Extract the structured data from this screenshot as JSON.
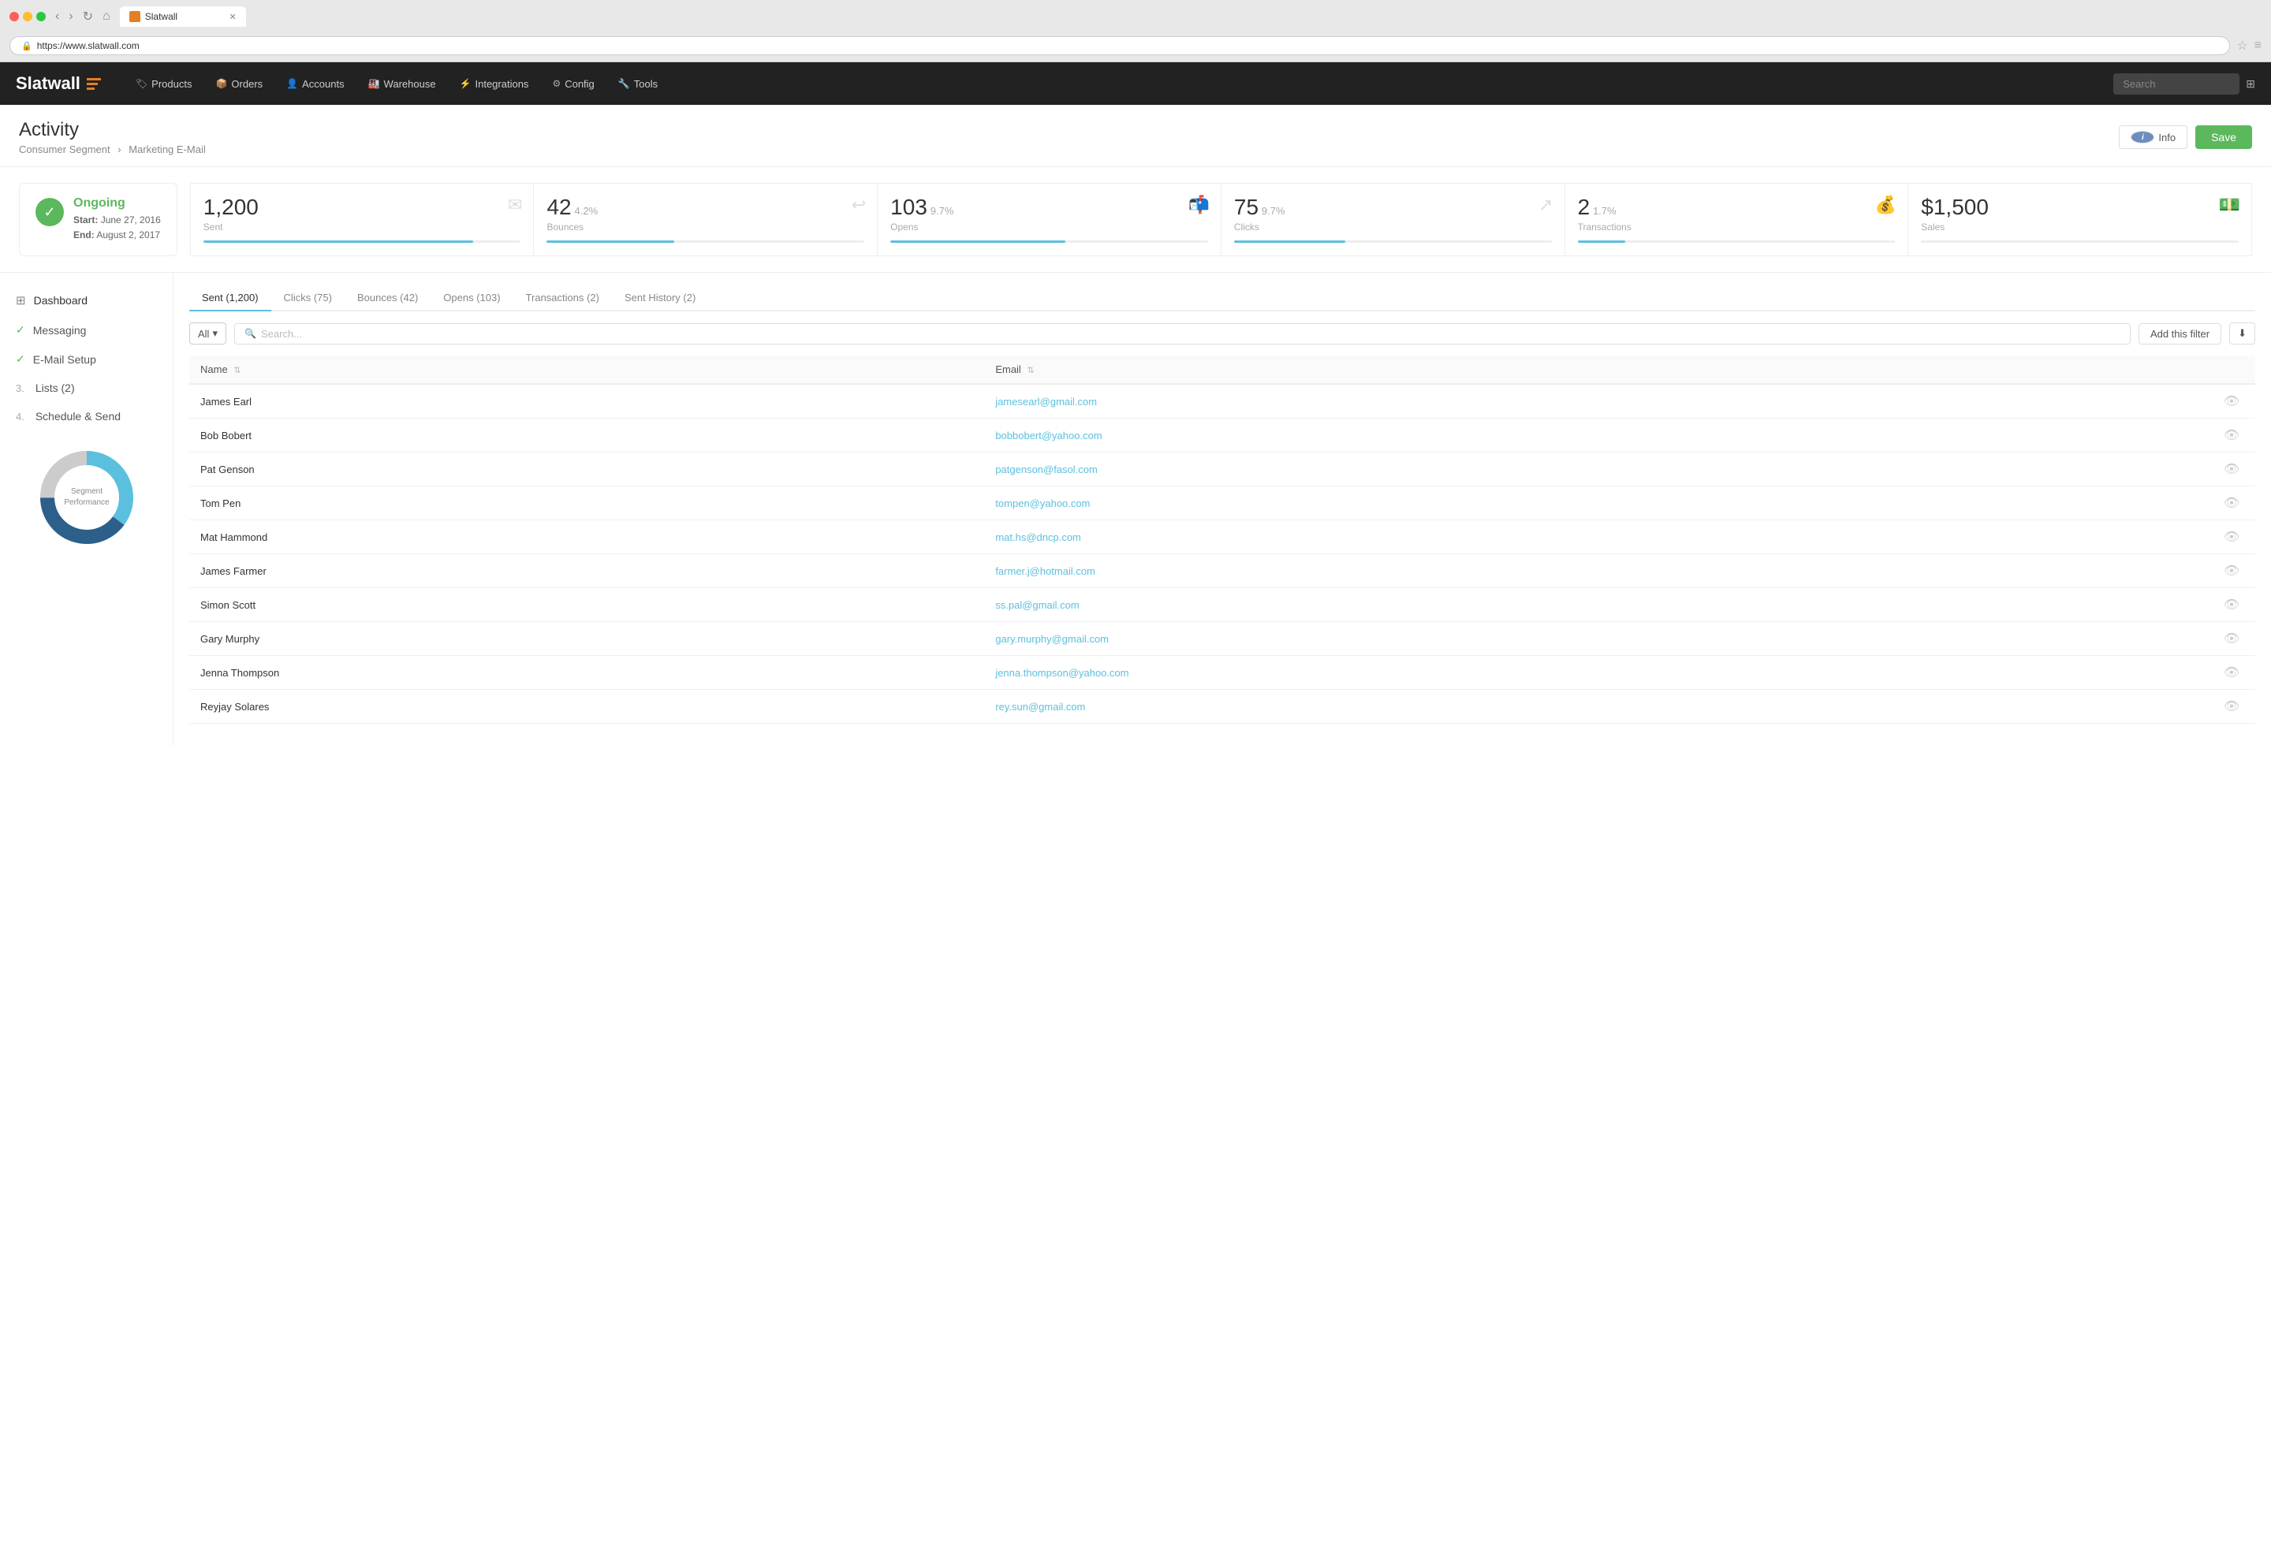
{
  "browser": {
    "tab_title": "Slatwall",
    "url": "https://www.slatwall.com"
  },
  "nav": {
    "brand": "Slatwall",
    "links": [
      {
        "label": "Products",
        "icon": "🏷"
      },
      {
        "label": "Orders",
        "icon": "📦"
      },
      {
        "label": "Accounts",
        "icon": "👤"
      },
      {
        "label": "Warehouse",
        "icon": "🏭"
      },
      {
        "label": "Integrations",
        "icon": "⚡"
      },
      {
        "label": "Config",
        "icon": "⚙"
      },
      {
        "label": "Tools",
        "icon": "🔧"
      }
    ],
    "search_placeholder": "Search"
  },
  "page": {
    "title": "Activity",
    "breadcrumb_parent": "Consumer Segment",
    "breadcrumb_child": "Marketing E-Mail",
    "btn_info": "Info",
    "btn_save": "Save"
  },
  "status": {
    "label": "Ongoing",
    "start_label": "Start:",
    "start_date": "June 27, 2016",
    "end_label": "End:",
    "end_date": "August 2, 2017"
  },
  "stats": [
    {
      "number": "1,200",
      "pct": "",
      "label": "Sent",
      "bar_pct": 85,
      "icon": "✉"
    },
    {
      "number": "42",
      "pct": "4.2%",
      "label": "Bounces",
      "bar_pct": 40,
      "icon": "↩"
    },
    {
      "number": "103",
      "pct": "9.7%",
      "label": "Opens",
      "bar_pct": 55,
      "icon": "✉"
    },
    {
      "number": "75",
      "pct": "9.7%",
      "label": "Clicks",
      "bar_pct": 35,
      "icon": "↗"
    },
    {
      "number": "2",
      "pct": "1.7%",
      "label": "Transactions",
      "bar_pct": 15,
      "icon": "💰"
    },
    {
      "number": "$1,500",
      "pct": "",
      "label": "Sales",
      "bar_pct": 0,
      "icon": "💵"
    }
  ],
  "sidebar": {
    "items": [
      {
        "label": "Dashboard",
        "type": "icon",
        "num": "",
        "checked": false
      },
      {
        "label": "Messaging",
        "type": "check",
        "num": "",
        "checked": true
      },
      {
        "label": "E-Mail Setup",
        "type": "check",
        "num": "",
        "checked": true
      },
      {
        "label": "Lists (2)",
        "type": "num",
        "num": "3.",
        "checked": false
      },
      {
        "label": "Schedule & Send",
        "type": "num",
        "num": "4.",
        "checked": false
      }
    ],
    "donut_label": "Segment\nPerformance"
  },
  "tabs": [
    {
      "label": "Sent (1,200)",
      "active": true
    },
    {
      "label": "Clicks (75)",
      "active": false
    },
    {
      "label": "Bounces (42)",
      "active": false
    },
    {
      "label": "Opens (103)",
      "active": false
    },
    {
      "label": "Transactions (2)",
      "active": false
    },
    {
      "label": "Sent History (2)",
      "active": false
    }
  ],
  "filter": {
    "all_label": "All",
    "search_placeholder": "Search...",
    "add_filter_label": "Add this filter"
  },
  "table": {
    "headers": [
      "Name",
      "Email"
    ],
    "rows": [
      {
        "name": "James Earl",
        "email": "jamesearl@gmail.com"
      },
      {
        "name": "Bob Bobert",
        "email": "bobbobert@yahoo.com"
      },
      {
        "name": "Pat Genson",
        "email": "patgenson@fasol.com"
      },
      {
        "name": "Tom Pen",
        "email": "tompen@yahoo.com"
      },
      {
        "name": "Mat Hammond",
        "email": "mat.hs@dncp.com"
      },
      {
        "name": "James Farmer",
        "email": "farmer.j@hotmail.com"
      },
      {
        "name": "Simon Scott",
        "email": "ss.pal@gmail.com"
      },
      {
        "name": "Gary Murphy",
        "email": "gary.murphy@gmail.com"
      },
      {
        "name": "Jenna Thompson",
        "email": "jenna.thompson@yahoo.com"
      },
      {
        "name": "Reyjay Solares",
        "email": "rey.sun@gmail.com"
      }
    ]
  },
  "donut": {
    "segments": [
      {
        "color": "#5bc0de",
        "value": 35
      },
      {
        "color": "#2c5f8a",
        "value": 40
      },
      {
        "color": "#ddd",
        "value": 25
      }
    ]
  }
}
